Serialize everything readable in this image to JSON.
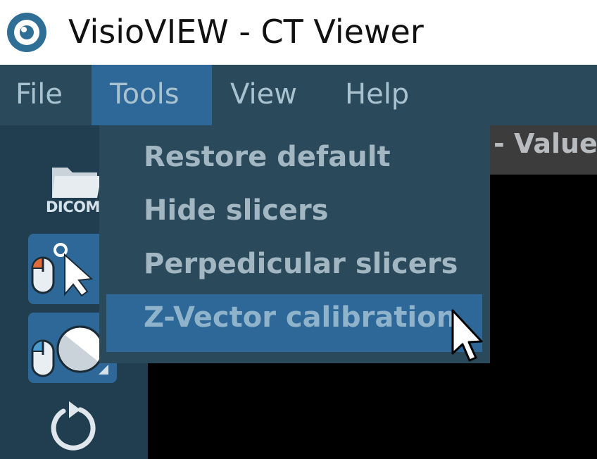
{
  "window": {
    "title": "VisioVIEW - CT Viewer",
    "icon": "eye-icon"
  },
  "menubar": {
    "items": [
      {
        "label": "File"
      },
      {
        "label": "Tools",
        "active": true
      },
      {
        "label": "View"
      },
      {
        "label": "Help"
      }
    ]
  },
  "tools_menu": {
    "items": [
      {
        "label": "Restore default"
      },
      {
        "label": "Hide slicers"
      },
      {
        "label": "Perpedicular slicers"
      },
      {
        "label": "Z-Vector calibration",
        "highlighted": true
      }
    ]
  },
  "toolbar": {
    "dicom_label": "DICOM",
    "buttons": [
      {
        "icon": "folder-icon",
        "label": "DICOM"
      },
      {
        "icon": "select-pointer-icon",
        "active": true
      },
      {
        "icon": "window-level-icon",
        "active": true
      },
      {
        "icon": "rotate-icon"
      }
    ]
  },
  "status": {
    "value_label": "- Value:"
  },
  "colors": {
    "menubar": "#2a4a5c",
    "highlight": "#2d6898",
    "toolbar": "#213e50",
    "viewport": "#000000"
  }
}
